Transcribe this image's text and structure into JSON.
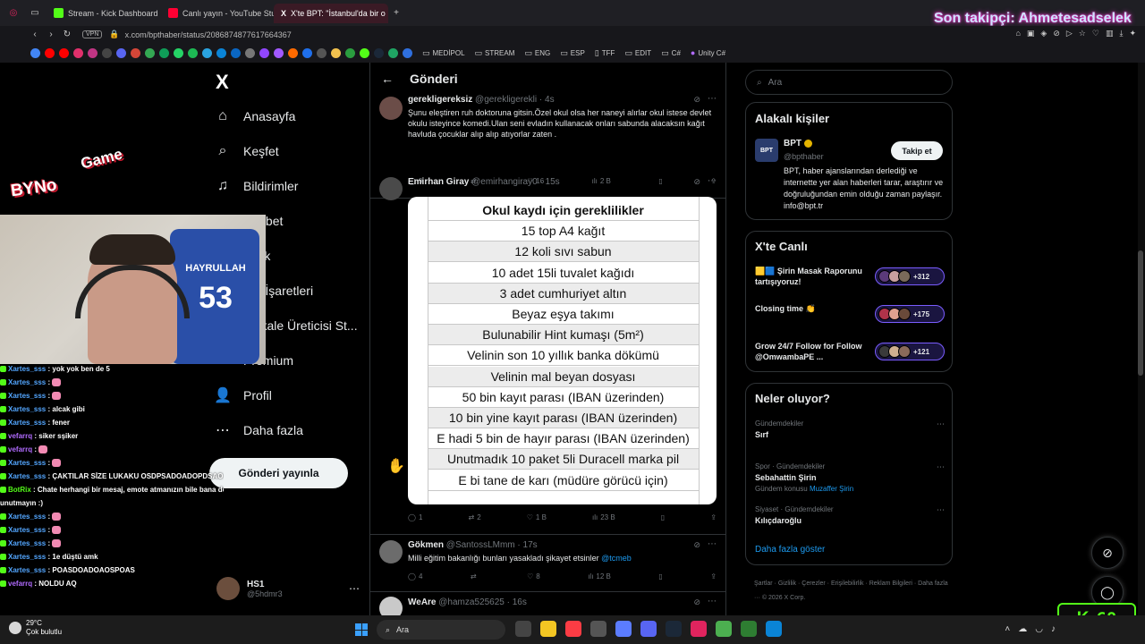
{
  "browser": {
    "tabs": [
      {
        "label": "Stream - Kick Dashboard",
        "color": "#53fc18",
        "active": false
      },
      {
        "label": "Canlı yayın - YouTube Studio",
        "color": "#ff0033",
        "active": false
      },
      {
        "label": "X'te BPT: \"İstanbul'da bir o",
        "color": "#ffffff",
        "active": true
      }
    ],
    "vpn_label": "VPN",
    "url": "x.com/bpthaber/status/2086874877617664367",
    "bookmark_folders": [
      "MEDİPOL",
      "STREAM",
      "ENG",
      "ESP",
      "TFF",
      "EDIT",
      "C#",
      "Unity C#"
    ]
  },
  "overlay": {
    "follower": "Son takipçi: Ahmetesadselek",
    "logo_main": "BYNo",
    "logo_game": "Game",
    "jersey_name": "HAYRULLAH",
    "jersey_number": "53",
    "kick_viewers": "68",
    "kick_letter": "K"
  },
  "chat": [
    {
      "user": "Xartes_sss",
      "msg": ": yok yok ben de 5",
      "type": "x",
      "emote": false
    },
    {
      "user": "Xartes_sss",
      "msg": ":",
      "type": "x",
      "emote": true
    },
    {
      "user": "Xartes_sss",
      "msg": ":",
      "type": "x",
      "emote": true
    },
    {
      "user": "Xartes_sss",
      "msg": ": alcak gibi",
      "type": "x",
      "emote": false
    },
    {
      "user": "Xartes_sss",
      "msg": ": fener",
      "type": "x",
      "emote": false
    },
    {
      "user": "vefarrq",
      "msg": ": siker sşiker",
      "type": "v",
      "emote": false
    },
    {
      "user": "vefarrq",
      "msg": ":",
      "type": "v",
      "emote": true
    },
    {
      "user": "Xartes_sss",
      "msg": ":",
      "type": "x",
      "emote": true
    },
    {
      "user": "Xartes_sss",
      "msg": ": ÇAKTILAR SİZE LUKAKU OSDPSADOADOPDSAO",
      "type": "x",
      "emote": false
    },
    {
      "user": "BotRix",
      "msg": ": Chate herhangi bir mesaj, emote atmanızın bile bana destek olduğunu",
      "type": "bot",
      "emote": false
    },
    {
      "user": "",
      "msg": "unutmayın :)",
      "type": "cont",
      "emote": false
    },
    {
      "user": "Xartes_sss",
      "msg": ":",
      "type": "x",
      "emote": true
    },
    {
      "user": "Xartes_sss",
      "msg": ":",
      "type": "x",
      "emote": true
    },
    {
      "user": "Xartes_sss",
      "msg": ":",
      "type": "x",
      "emote": true
    },
    {
      "user": "Xartes_sss",
      "msg": ": 1e düştü amk",
      "type": "x",
      "emote": false
    },
    {
      "user": "Xartes_sss",
      "msg": ": POASDOADOAOSPOAS",
      "type": "x",
      "emote": false
    },
    {
      "user": "vefarrq",
      "msg": ": NOLDU AQ",
      "type": "v",
      "emote": false
    }
  ],
  "nav": {
    "logo": "X",
    "items": [
      {
        "label": "Anasayfa",
        "icon": "home-icon",
        "glyph": "⌂"
      },
      {
        "label": "Keşfet",
        "icon": "search-icon",
        "glyph": "⌕"
      },
      {
        "label": "Bildirimler",
        "icon": "bell-icon",
        "glyph": "♫"
      },
      {
        "label": "Sohbet",
        "icon": "chat-icon",
        "glyph": "✉"
      },
      {
        "label": "Grok",
        "icon": "grok-icon",
        "glyph": "◩"
      },
      {
        "label": "Yer İşaretleri",
        "icon": "bookmark-icon",
        "glyph": "▯"
      },
      {
        "label": "Makale Üreticisi St...",
        "icon": "article-icon",
        "glyph": "▤"
      },
      {
        "label": "Premium",
        "icon": "premium-icon",
        "glyph": "✕"
      },
      {
        "label": "Profil",
        "icon": "profile-icon",
        "glyph": "👤"
      },
      {
        "label": "Daha fazla",
        "icon": "more-icon",
        "glyph": "⋯"
      }
    ],
    "post_button": "Gönderi yayınla",
    "account_name": "HS1",
    "account_handle": "@5hdmr3"
  },
  "column": {
    "title": "Gönderi",
    "tweets": [
      {
        "name": "gerekligereksiz",
        "handle": "@gerekligerekli",
        "time": "· 4s",
        "text": "Şunu eleştiren ruh doktoruna gitsin.Özel okul olsa her naneyi alırlar okul istese devlet okulu isteyince komedi.Ulan seni evladın kullanacak onları sabunda alacaksın kağıt havluda çocuklar alıp alıp atıyorlar zaten .",
        "replies": "9",
        "reposts": "",
        "likes": "16",
        "views": "2 B",
        "avatar_color": "#6b4d48"
      },
      {
        "name": "Emirhan Giray",
        "handle": "@emirhangiray0",
        "time": "· 15s",
        "text": "",
        "replies": "1",
        "reposts": "2",
        "likes": "1 B",
        "views": "23 B",
        "avatar_color": "#4a4a4a"
      },
      {
        "name": "Gökmen",
        "handle": "@SantossLMmm",
        "time": "· 17s",
        "text": "Milli eğitim bakanlığı bunları yasakladı şikayet etsinler",
        "mention": "@tcmeb",
        "replies": "4",
        "reposts": "",
        "likes": "8",
        "views": "12 B",
        "avatar_color": "#6c6c6c"
      },
      {
        "name": "WeAre",
        "handle": "@hamza525625",
        "time": "· 16s",
        "text": "",
        "avatar_color": "#c9c9c9"
      }
    ],
    "image_title": "Okul kaydı için gereklilikler",
    "image_rows": [
      "15 top A4 kağıt",
      "12 koli sıvı sabun",
      "10 adet 15li tuvalet kağıdı",
      "3 adet cumhuriyet altın",
      "Beyaz eşya takımı",
      "Bulunabilir Hint kumaşı (5m²)",
      "Velinin son 10 yıllık banka dökümü",
      "Velinin mal beyan dosyası",
      "50 bin kayıt parası (IBAN üzerinden)",
      "10 bin yine kayıt parası (IBAN üzerinden)",
      "E hadi 5 bin de hayır parası (IBAN üzerinden)",
      "Unutmadık 10 paket 5li Duracell marka pil",
      "E bi tane de karı (müdüre görücü için)"
    ]
  },
  "right": {
    "search_placeholder": "Ara",
    "related_title": "Alakalı kişiler",
    "bpt_avatar": "BPT",
    "bpt_name": "BPT",
    "bpt_handle": "@bpthaber",
    "follow_label": "Takip et",
    "bpt_bio": "BPT, haber ajanslarından derlediği ve internette yer alan haberleri tarar, araştırır ve doğruluğundan emin olduğu zaman paylaşır. info@bpt.tr",
    "live_title": "X'te Canlı",
    "live": [
      {
        "title": "🟨🟦 Şirin Masak Raporunu tartışıyoruz!",
        "count": "+312"
      },
      {
        "title": "Closing time 👏",
        "count": "+175"
      },
      {
        "title": "Grow 24/7 Follow for Follow @OmwambaPE ...",
        "count": "+121"
      }
    ],
    "trends_title": "Neler oluyor?",
    "trends": [
      {
        "cat": "Gündemdekiler",
        "name": "Sırf",
        "sub": "",
        "sub_link": ""
      },
      {
        "cat": "Spor · Gündemdekiler",
        "name": "Sebahattin Şirin",
        "sub": "Gündem konusu",
        "sub_link": "Muzaffer Şirin"
      },
      {
        "cat": "Siyaset · Gündemdekiler",
        "name": "Kılıçdaroğlu",
        "sub": "",
        "sub_link": ""
      }
    ],
    "show_more": "Daha fazla göster",
    "footer": "Şartlar · Gizlilik · Çerezler · Erişilebilirlik · Reklam Bilgileri · Daha fazla ··· © 2026 X Corp."
  },
  "taskbar": {
    "temperature": "29°C",
    "weather": "Çok bulutlu",
    "search_placeholder": "Ara"
  }
}
